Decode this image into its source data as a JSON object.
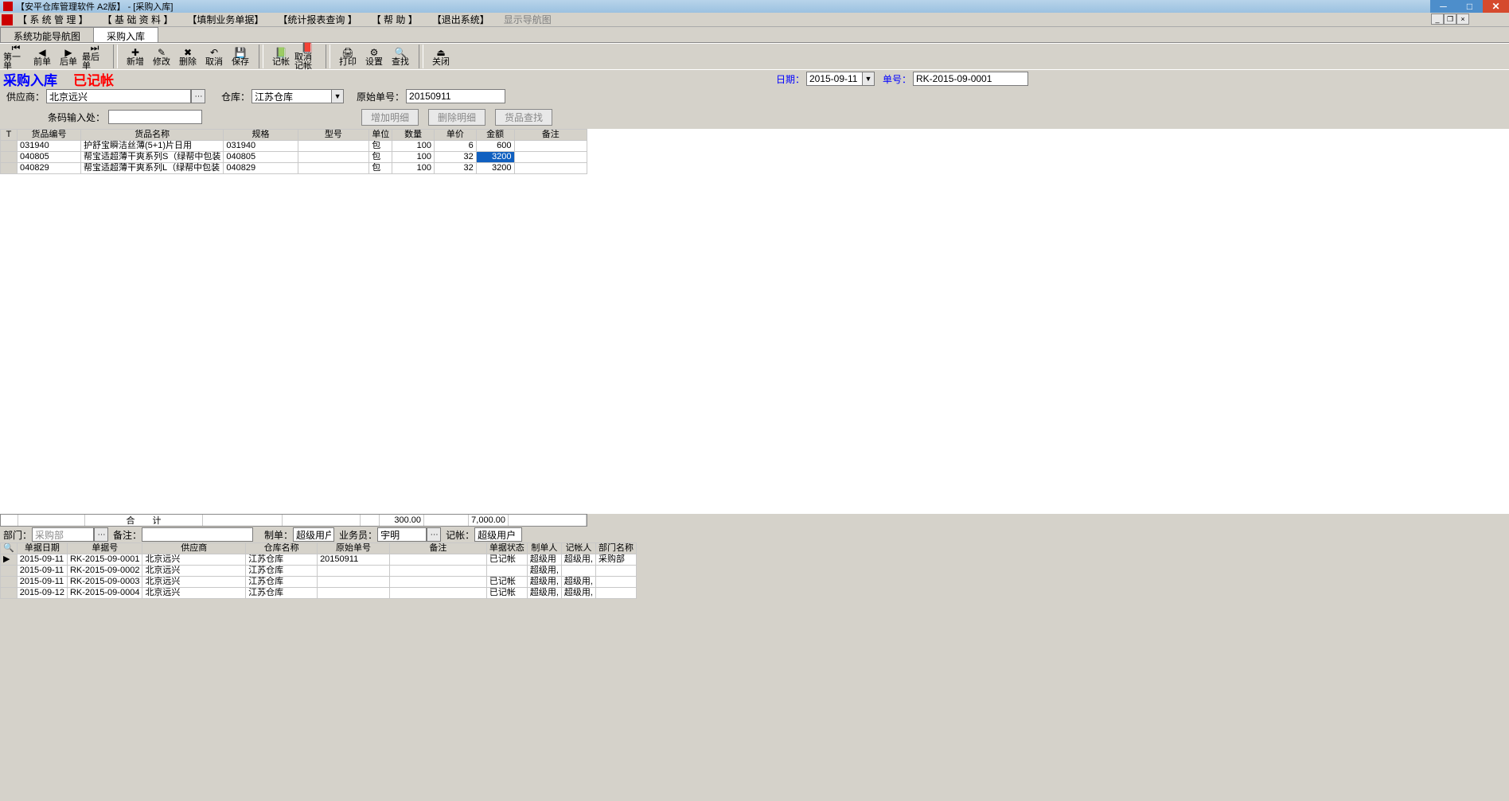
{
  "title": "【安平仓库管理软件 A2版】 - [采购入库]",
  "menu": [
    "【 系 统 管 理 】",
    "【 基 础 资 料 】",
    "【填制业务单据】",
    "【统计报表查询 】",
    "【 帮 助 】",
    "【退出系统】",
    "显示导航图"
  ],
  "apptabs": [
    {
      "label": "系统功能导航图",
      "active": false
    },
    {
      "label": "采购入库",
      "active": true
    }
  ],
  "toolbar": [
    {
      "l": "第一单",
      "i": "⏮"
    },
    {
      "l": "前单",
      "i": "◀"
    },
    {
      "l": "后单",
      "i": "▶"
    },
    {
      "l": "最后单",
      "i": "⏭"
    },
    null,
    {
      "l": "新增",
      "i": "✚"
    },
    {
      "l": "修改",
      "i": "✎"
    },
    {
      "l": "删除",
      "i": "✖"
    },
    {
      "l": "取消",
      "i": "↶"
    },
    {
      "l": "保存",
      "i": "💾"
    },
    null,
    {
      "l": "记帐",
      "i": "📗"
    },
    {
      "l": "取消记帐",
      "i": "📕"
    },
    null,
    {
      "l": "打印",
      "i": "🖨"
    },
    {
      "l": "设置",
      "i": "⚙"
    },
    {
      "l": "查找",
      "i": "🔍"
    },
    null,
    {
      "l": "关闭",
      "i": "⏏"
    }
  ],
  "page": {
    "title": "采购入库",
    "posted": "已记帐"
  },
  "form": {
    "date_label": "日期：",
    "date": "2015-09-11",
    "docno_label": "单号：",
    "docno": "RK-2015-09-0001",
    "supplier_label": "供应商：",
    "supplier": "北京远兴",
    "warehouse_label": "仓库：",
    "warehouse": "江苏仓库",
    "origdoc_label": "原始单号：",
    "origdoc": "20150911",
    "barcode_label": "条码输入处："
  },
  "btns": {
    "add": "增加明细",
    "del": "删除明细",
    "find": "货品查找"
  },
  "cols": [
    "T",
    "货品编号",
    "货品名称",
    "规格",
    "型号",
    "单位",
    "数量",
    "单价",
    "金额",
    "备注"
  ],
  "rows": [
    {
      "code": "031940",
      "name": "护舒宝瞬洁丝薄(5+1)片日用",
      "spec": "031940",
      "unit": "包",
      "qty": "100",
      "price": "6",
      "amt": "600"
    },
    {
      "code": "040805",
      "name": "帮宝适超薄干爽系列S（绿帮中包装",
      "spec": "040805",
      "unit": "包",
      "qty": "100",
      "price": "32",
      "amt": "3200",
      "sel": true
    },
    {
      "code": "040829",
      "name": "帮宝适超薄干爽系列L（绿帮中包装",
      "spec": "040829",
      "unit": "包",
      "qty": "100",
      "price": "32",
      "amt": "3200"
    }
  ],
  "totals": {
    "label": "合　　计",
    "qty": "300.00",
    "amt": "7,000.00"
  },
  "footer": {
    "dept_label": "部门：",
    "dept": "采购部",
    "remark_label": "备注：",
    "maker_label": "制单：",
    "maker": "超级用户",
    "clerk_label": "业务员：",
    "clerk": "宇明",
    "poster_label": "记帐：",
    "poster": "超级用户"
  },
  "bcols": [
    "",
    "单据日期",
    "单据号",
    "供应商",
    "仓库名称",
    "原始单号",
    "备注",
    "单据状态",
    "制单人",
    "记帐人",
    "部门名称"
  ],
  "brows": [
    {
      "d": "2015-09-11",
      "no": "RK-2015-09-0001",
      "sup": "北京远兴",
      "wh": "江苏仓库",
      "od": "20150911",
      "st": "已记帐",
      "mk": "超级用",
      "pt": "超级用,",
      "dp": "采购部",
      "cur": true
    },
    {
      "d": "2015-09-11",
      "no": "RK-2015-09-0002",
      "sup": "北京远兴",
      "wh": "江苏仓库",
      "od": "",
      "st": "",
      "mk": "超级用,",
      "pt": "",
      "dp": ""
    },
    {
      "d": "2015-09-11",
      "no": "RK-2015-09-0003",
      "sup": "北京远兴",
      "wh": "江苏仓库",
      "od": "",
      "st": "已记帐",
      "mk": "超级用,",
      "pt": "超级用,",
      "dp": ""
    },
    {
      "d": "2015-09-12",
      "no": "RK-2015-09-0004",
      "sup": "北京远兴",
      "wh": "江苏仓库",
      "od": "",
      "st": "已记帐",
      "mk": "超级用,",
      "pt": "超级用,",
      "dp": ""
    }
  ]
}
